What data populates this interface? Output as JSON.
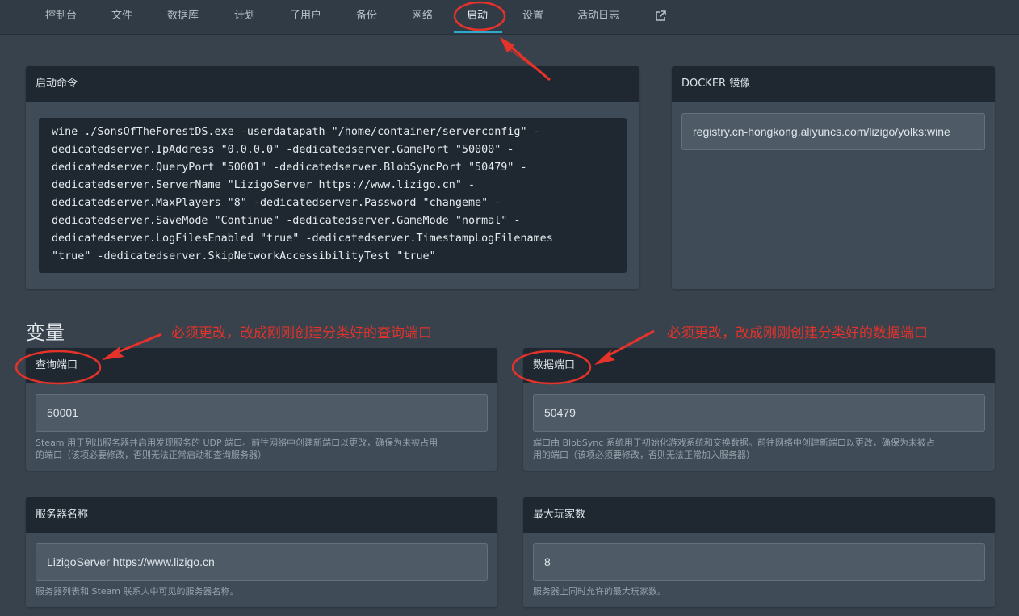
{
  "nav": {
    "tabs": [
      "控制台",
      "文件",
      "数据库",
      "计划",
      "子用户",
      "备份",
      "网络",
      "启动",
      "设置",
      "活动日志"
    ],
    "active": "启动",
    "external_icon": "external-link-icon"
  },
  "startup": {
    "title": "启动命令",
    "command_lines": [
      "wine ./SonsOfTheForestDS.exe -userdatapath \"/home/container/serverconfig\" -",
      "dedicatedserver.IpAddress \"0.0.0.0\" -dedicatedserver.GamePort \"50000\" -",
      "dedicatedserver.QueryPort \"50001\" -dedicatedserver.BlobSyncPort \"50479\" -",
      "dedicatedserver.ServerName \"LizigoServer https://www.lizigo.cn\" -",
      "dedicatedserver.MaxPlayers \"8\" -dedicatedserver.Password \"changeme\" -",
      "dedicatedserver.SaveMode \"Continue\" -dedicatedserver.GameMode \"normal\" -",
      "dedicatedserver.LogFilesEnabled \"true\" -dedicatedserver.TimestampLogFilenames",
      "\"true\" -dedicatedserver.SkipNetworkAccessibilityTest \"true\""
    ]
  },
  "docker": {
    "title": "DOCKER 镜像",
    "image": "registry.cn-hongkong.aliyuncs.com/lizigo/yolks:wine"
  },
  "variables": {
    "title": "变量",
    "items": [
      {
        "label": "查询端口",
        "value": "50001",
        "desc_lines": [
          "Steam 用于列出服务器并启用发现服务的 UDP 端口。前往网络中创建新端口以更改，确保为未被占用",
          "的端口（该项必要修改，否则无法正常启动和查询服务器）"
        ]
      },
      {
        "label": "数据端口",
        "value": "50479",
        "desc_lines": [
          "端口由 BlobSync 系统用于初始化游戏系统和交换数据。前往网络中创建新端口以更改，确保为未被占",
          "用的端口（该项必须要修改，否则无法正常加入服务器）"
        ]
      },
      {
        "label": "服务器名称",
        "value": "LizigoServer https://www.lizigo.cn",
        "desc_lines": [
          "服务器列表和 Steam 联系人中可见的服务器名称。"
        ]
      },
      {
        "label": "最大玩家数",
        "value": "8",
        "desc_lines": [
          "服务器上同时允许的最大玩家数。"
        ]
      }
    ]
  },
  "annotations": {
    "query_note": "必须更改，改成刚刚创建分类好的查询端口",
    "data_note": "必须更改，改成刚刚创建分类好的数据端口",
    "color": "#e5322a"
  }
}
